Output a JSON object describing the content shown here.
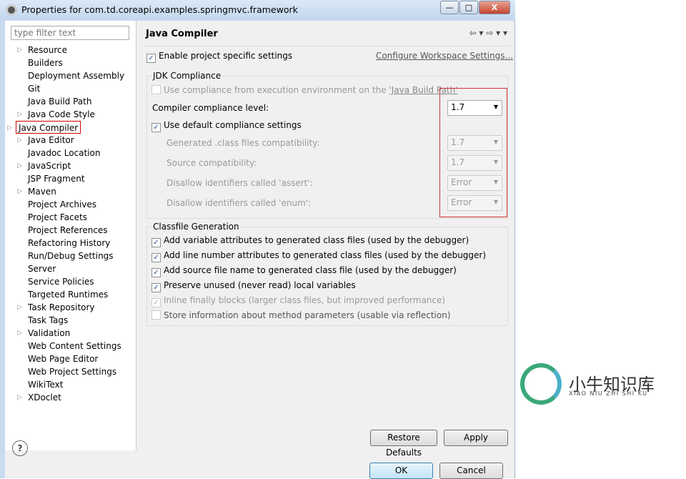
{
  "window": {
    "title": "Properties for com.td.coreapi.examples.springmvc.framework",
    "minimize": "—",
    "maximize": "□",
    "close": "X"
  },
  "sidebar": {
    "filter_placeholder": "type filter text",
    "items": [
      {
        "label": "Resource",
        "expandable": true
      },
      {
        "label": "Builders"
      },
      {
        "label": "Deployment Assembly"
      },
      {
        "label": "Git"
      },
      {
        "label": "Java Build Path"
      },
      {
        "label": "Java Code Style",
        "expandable": true
      },
      {
        "label": "Java Compiler",
        "expandable": true,
        "selected": true
      },
      {
        "label": "Java Editor",
        "expandable": true
      },
      {
        "label": "Javadoc Location"
      },
      {
        "label": "JavaScript",
        "expandable": true
      },
      {
        "label": "JSP Fragment"
      },
      {
        "label": "Maven",
        "expandable": true
      },
      {
        "label": "Project Archives"
      },
      {
        "label": "Project Facets"
      },
      {
        "label": "Project References"
      },
      {
        "label": "Refactoring History"
      },
      {
        "label": "Run/Debug Settings"
      },
      {
        "label": "Server"
      },
      {
        "label": "Service Policies"
      },
      {
        "label": "Targeted Runtimes"
      },
      {
        "label": "Task Repository",
        "expandable": true
      },
      {
        "label": "Task Tags"
      },
      {
        "label": "Validation",
        "expandable": true
      },
      {
        "label": "Web Content Settings"
      },
      {
        "label": "Web Page Editor"
      },
      {
        "label": "Web Project Settings"
      },
      {
        "label": "WikiText"
      },
      {
        "label": "XDoclet",
        "expandable": true
      }
    ]
  },
  "main": {
    "title": "Java Compiler",
    "nav": "⇦ ▾  ⇨ ▾  ▾",
    "enable_specific": {
      "label": "Enable project specific settings",
      "checked": true
    },
    "configure_link": "Configure Workspace Settings...",
    "jdk": {
      "label": "JDK Compliance",
      "use_env": {
        "label": "Use compliance from execution environment on the ",
        "link": "'Java Build Path'",
        "checked": false
      },
      "level_label": "Compiler compliance level:",
      "level_value": "1.7",
      "use_default": {
        "label": "Use default compliance settings",
        "checked": true
      },
      "generated_label": "Generated .class files compatibility:",
      "generated_value": "1.7",
      "source_label": "Source compatibility:",
      "source_value": "1.7",
      "assert_label": "Disallow identifiers called 'assert':",
      "assert_value": "Error",
      "enum_label": "Disallow identifiers called 'enum':",
      "enum_value": "Error"
    },
    "classfile": {
      "label": "Classfile Generation",
      "options": [
        {
          "label": "Add variable attributes to generated class files (used by the debugger)",
          "checked": true
        },
        {
          "label": "Add line number attributes to generated class files (used by the debugger)",
          "checked": true
        },
        {
          "label": "Add source file name to generated class file (used by the debugger)",
          "checked": true
        },
        {
          "label": "Preserve unused (never read) local variables",
          "checked": true
        },
        {
          "label": "Inline finally blocks (larger class files, but improved performance)",
          "checked": true,
          "disabled": true
        },
        {
          "label": "Store information about method parameters (usable via reflection)",
          "checked": false
        }
      ]
    },
    "restore_defaults": "Restore Defaults",
    "apply": "Apply"
  },
  "footer": {
    "help": "?",
    "ok": "OK",
    "cancel": "Cancel"
  },
  "watermark": {
    "cn": "小牛知识库",
    "en": "XIAO NIU ZHI SHI KU"
  },
  "colors": {
    "highlight": "#cc3333",
    "logo_green": "#3aa87a"
  }
}
